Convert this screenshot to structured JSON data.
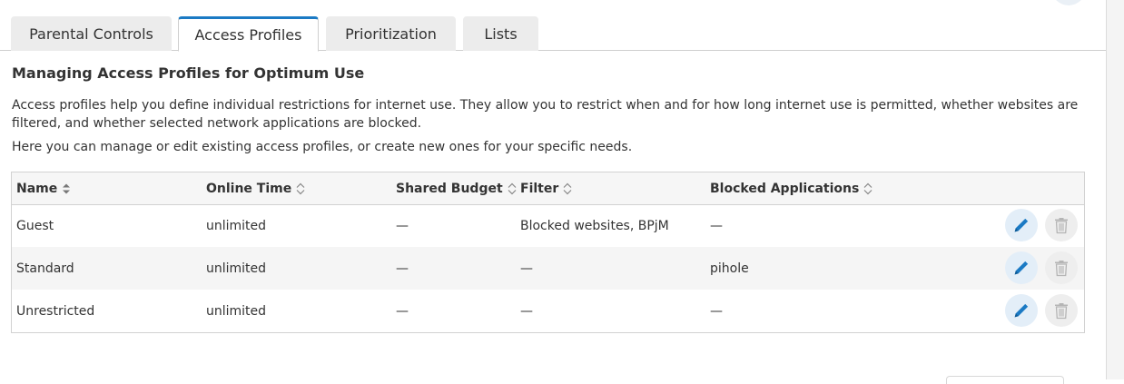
{
  "tabs": [
    {
      "label": "Parental Controls",
      "active": false
    },
    {
      "label": "Access Profiles",
      "active": true
    },
    {
      "label": "Prioritization",
      "active": false
    },
    {
      "label": "Lists",
      "active": false
    }
  ],
  "section": {
    "title": "Managing Access Profiles for Optimum Use",
    "description": "Access profiles help you define individual restrictions for internet use. They allow you to restrict when and for how long internet use is permitted, whether websites are filtered, and whether selected network applications are blocked.",
    "subdescription": "Here you can manage or edit existing access profiles, or create new ones for your specific needs."
  },
  "table": {
    "columns": [
      "Name",
      "Online Time",
      "Shared Budget",
      "Filter",
      "Blocked Applications"
    ],
    "rows": [
      {
        "name": "Guest",
        "online_time": "unlimited",
        "shared_budget": "—",
        "filter": "Blocked websites, BPjM",
        "blocked_apps": "—"
      },
      {
        "name": "Standard",
        "online_time": "unlimited",
        "shared_budget": "—",
        "filter": "—",
        "blocked_apps": "pihole"
      },
      {
        "name": "Unrestricted",
        "online_time": "unlimited",
        "shared_budget": "—",
        "filter": "—",
        "blocked_apps": "—"
      }
    ]
  },
  "icons": {
    "edit": "pencil-icon",
    "delete": "trash-icon",
    "sort_active": "sort-both-filled-icon",
    "sort": "sort-both-outline-icon"
  },
  "colors": {
    "accent": "#1b7ac4",
    "edit_bg": "#e3eef8",
    "delete_bg": "#eeeeee",
    "delete_icon": "#b5b5b5"
  }
}
